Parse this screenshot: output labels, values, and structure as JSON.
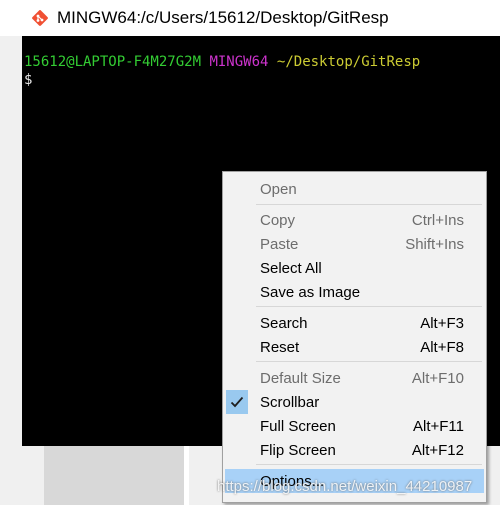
{
  "window": {
    "icon": "git-diamond-icon",
    "title": "MINGW64:/c/Users/15612/Desktop/GitResp"
  },
  "terminal": {
    "user_host": "15612@LAPTOP-F4M27G2M",
    "system": "MINGW64",
    "path": "~/Desktop/GitResp",
    "prompt_symbol": "$",
    "colors": {
      "user": "#33cc33",
      "system": "#cc33cc",
      "path": "#cccc33",
      "background": "#000000"
    }
  },
  "context_menu": {
    "items": [
      {
        "label": "Open",
        "shortcut": "",
        "enabled": false
      },
      {
        "label": "Copy",
        "shortcut": "Ctrl+Ins",
        "enabled": false
      },
      {
        "label": "Paste",
        "shortcut": "Shift+Ins",
        "enabled": false
      },
      {
        "label": "Select All",
        "shortcut": "",
        "enabled": true
      },
      {
        "label": "Save as Image",
        "shortcut": "",
        "enabled": true
      },
      {
        "label": "Search",
        "shortcut": "Alt+F3",
        "enabled": true
      },
      {
        "label": "Reset",
        "shortcut": "Alt+F8",
        "enabled": true
      },
      {
        "label": "Default Size",
        "shortcut": "Alt+F10",
        "enabled": false
      },
      {
        "label": "Scrollbar",
        "shortcut": "",
        "enabled": true,
        "checked": true
      },
      {
        "label": "Full Screen",
        "shortcut": "Alt+F11",
        "enabled": true
      },
      {
        "label": "Flip Screen",
        "shortcut": "Alt+F12",
        "enabled": true
      },
      {
        "label": "Options...",
        "shortcut": "",
        "enabled": true,
        "highlighted": true
      }
    ],
    "highlight_color": "#a8d1f7"
  },
  "watermark": "https://blog.csdn.net/weixin_44210987"
}
